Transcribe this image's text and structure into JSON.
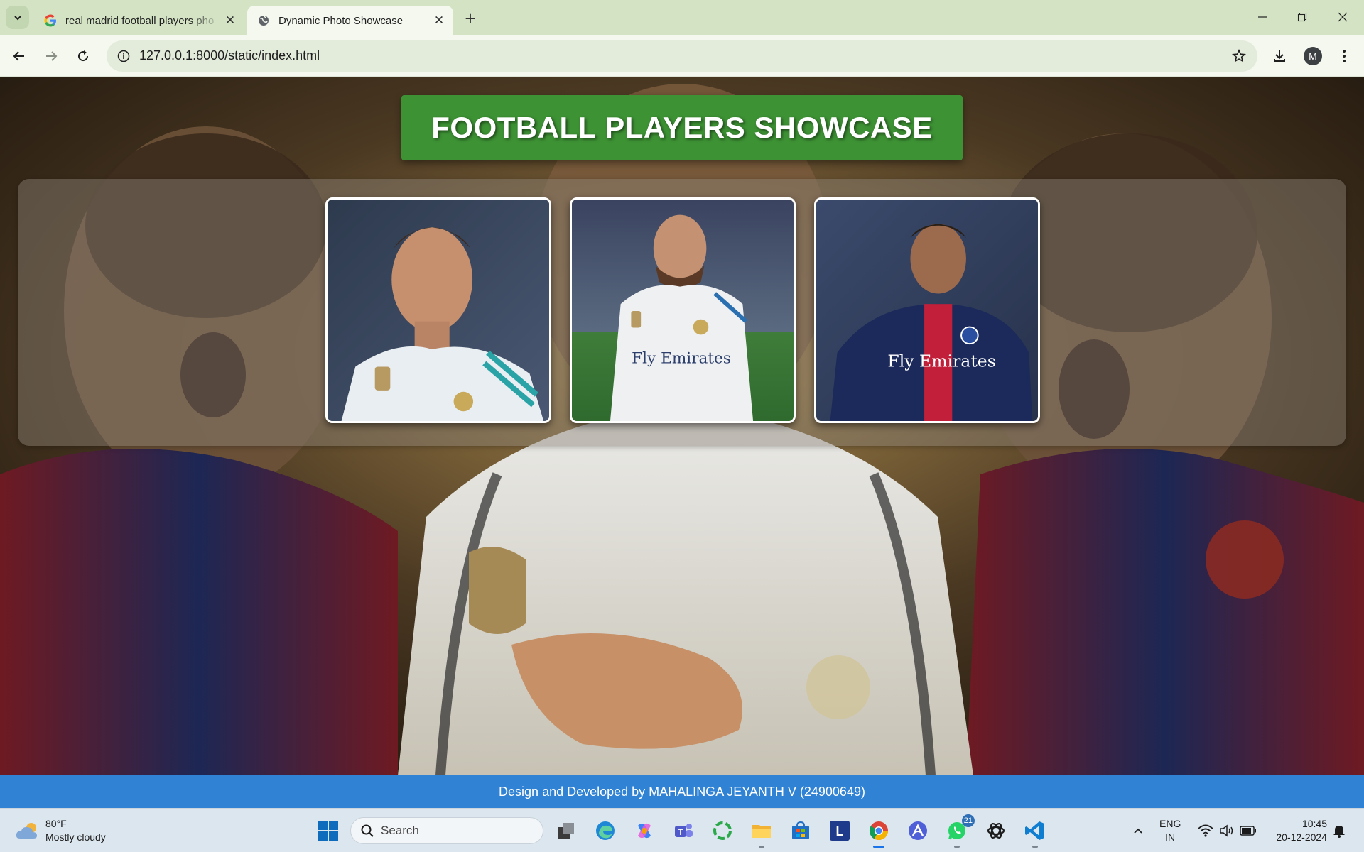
{
  "browser": {
    "tabs": [
      {
        "title": "real madrid football players pho",
        "active": false,
        "favicon": "google-icon"
      },
      {
        "title": "Dynamic Photo Showcase",
        "active": true,
        "favicon": "globe-icon"
      }
    ],
    "url": "127.0.0.1:8000/static/index.html",
    "profile_initial": "M"
  },
  "page": {
    "heading": "FOOTBALL PLAYERS SHOWCASE",
    "photos": [
      {
        "jersey_sponsor": "",
        "kit": "white"
      },
      {
        "jersey_sponsor": "Fly Emirates",
        "kit": "white"
      },
      {
        "jersey_sponsor": "Fly Emirates",
        "kit": "navy"
      }
    ],
    "footer": "Design and Developed by MAHALINGA JEYANTH V (24900649)"
  },
  "colors": {
    "header_green": "#3d9234",
    "footer_blue": "#2f82d4",
    "tabbar": "#d3e3c4",
    "toolbar": "#f4f8ef"
  },
  "taskbar": {
    "weather_temp": "80°F",
    "weather_desc": "Mostly cloudy",
    "search_placeholder": "Search",
    "whatsapp_badge": "21",
    "lang_line1": "ENG",
    "lang_line2": "IN",
    "time": "10:45",
    "date": "20-12-2024",
    "apps": [
      "windows-start",
      "search",
      "task-view",
      "edge",
      "copilot",
      "teams",
      "circle-app",
      "file-explorer",
      "store",
      "l-app",
      "chrome",
      "arc-app",
      "whatsapp",
      "chatgpt",
      "vscode"
    ]
  }
}
